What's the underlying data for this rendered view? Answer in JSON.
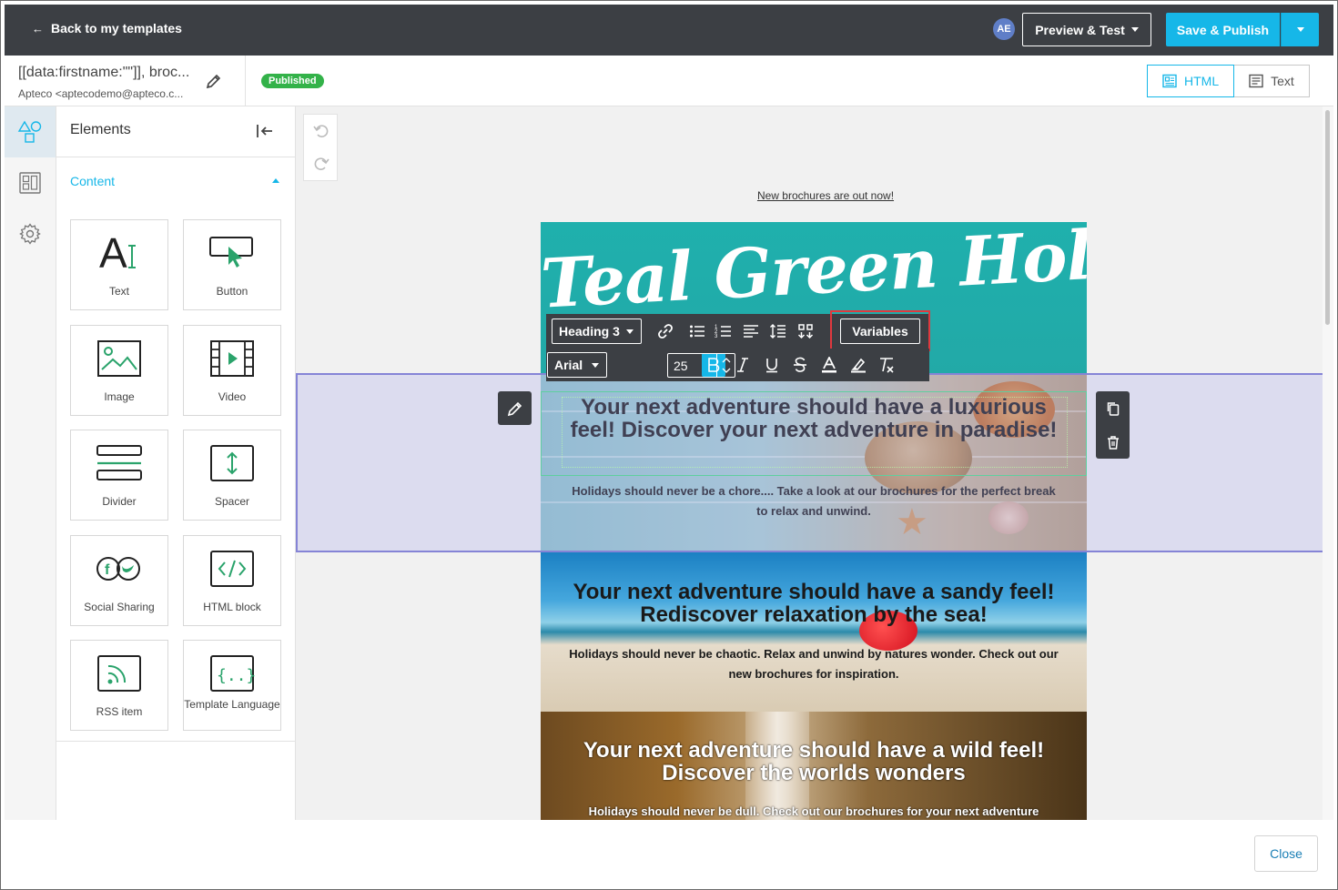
{
  "topbar": {
    "back_label": "Back to my templates",
    "avatar_initials": "AE",
    "preview_label": "Preview & Test",
    "publish_label": "Save & Publish"
  },
  "template": {
    "name": "[[data:firstname:\"\"]], broc...",
    "sender": "Apteco <aptecodemo@apteco.c...",
    "status": "Published"
  },
  "view_modes": [
    {
      "label": "HTML",
      "active": true
    },
    {
      "label": "Text",
      "active": false
    }
  ],
  "panel": {
    "title": "Elements",
    "section_label": "Content",
    "tiles": [
      {
        "label": "Text",
        "icon": "text-icon"
      },
      {
        "label": "Button",
        "icon": "button-icon"
      },
      {
        "label": "Image",
        "icon": "image-icon"
      },
      {
        "label": "Video",
        "icon": "video-icon"
      },
      {
        "label": "Divider",
        "icon": "divider-icon"
      },
      {
        "label": "Spacer",
        "icon": "spacer-icon"
      },
      {
        "label": "Social Sharing",
        "icon": "social-sharing-icon"
      },
      {
        "label": "HTML block",
        "icon": "html-block-icon"
      },
      {
        "label": "RSS item",
        "icon": "rss-icon"
      },
      {
        "label": "Template Language",
        "icon": "template-language-icon"
      }
    ]
  },
  "toolbar": {
    "block_format": "Heading 3",
    "font_family": "Arial",
    "font_size": "25",
    "variables_label": "Variables"
  },
  "email": {
    "top_link": "New brochures are out now!",
    "banner_title": "Teal Green Holidays",
    "sections": [
      {
        "heading": "Your next adventure should have a luxurious feel! Discover your next adventure in paradise!",
        "body": "Holidays should never be a chore.... Take a look at our brochures for the perfect break to relax and unwind."
      },
      {
        "heading": "Your next adventure should have a sandy feel! Rediscover relaxation by the sea!",
        "body": "Holidays should never be chaotic. Relax and unwind by natures wonder. Check out our new brochures for inspiration."
      },
      {
        "heading": "Your next adventure should have a wild feel! Discover the worlds wonders",
        "body": "Holidays should never be dull. Check out our brochures for your next adventure"
      }
    ]
  },
  "footer": {
    "close_label": "Close"
  },
  "colors": {
    "accent": "#16b7e8",
    "topbar": "#3c3f44",
    "status_green": "#33b249",
    "highlight_red": "#e0383e"
  }
}
